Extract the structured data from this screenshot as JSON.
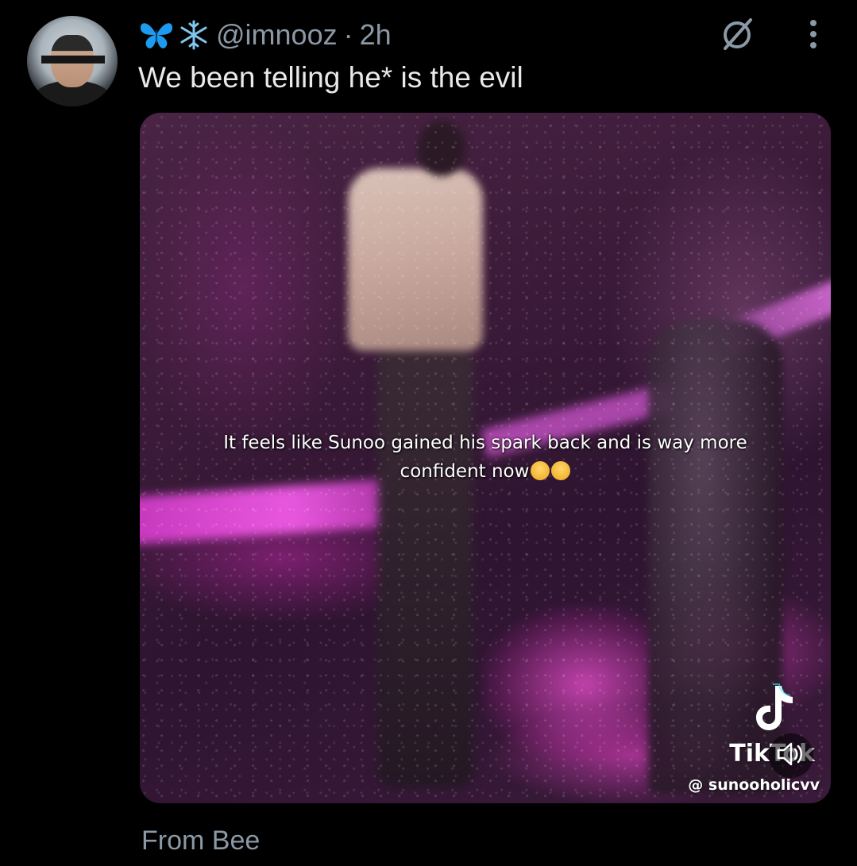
{
  "colors": {
    "background": "#000000",
    "primary_text": "#e7e9ea",
    "secondary_text": "#8b98a5",
    "butterfly": "#1d9bf0",
    "snowflake": "#7fc6f0"
  },
  "tweet": {
    "header_icons": [
      "butterfly-icon",
      "snowflake-icon"
    ],
    "handle": "@imnooz",
    "separator": "·",
    "timestamp": "2h",
    "text": "We been telling he* is the evil",
    "footer": "From Bee"
  },
  "media": {
    "caption_line_1": "It feels like Sunoo gained his spark back and is way more",
    "caption_line_2": "confident now",
    "watermark_brand": "TikTok",
    "watermark_user": "@ sunooholicvv"
  }
}
